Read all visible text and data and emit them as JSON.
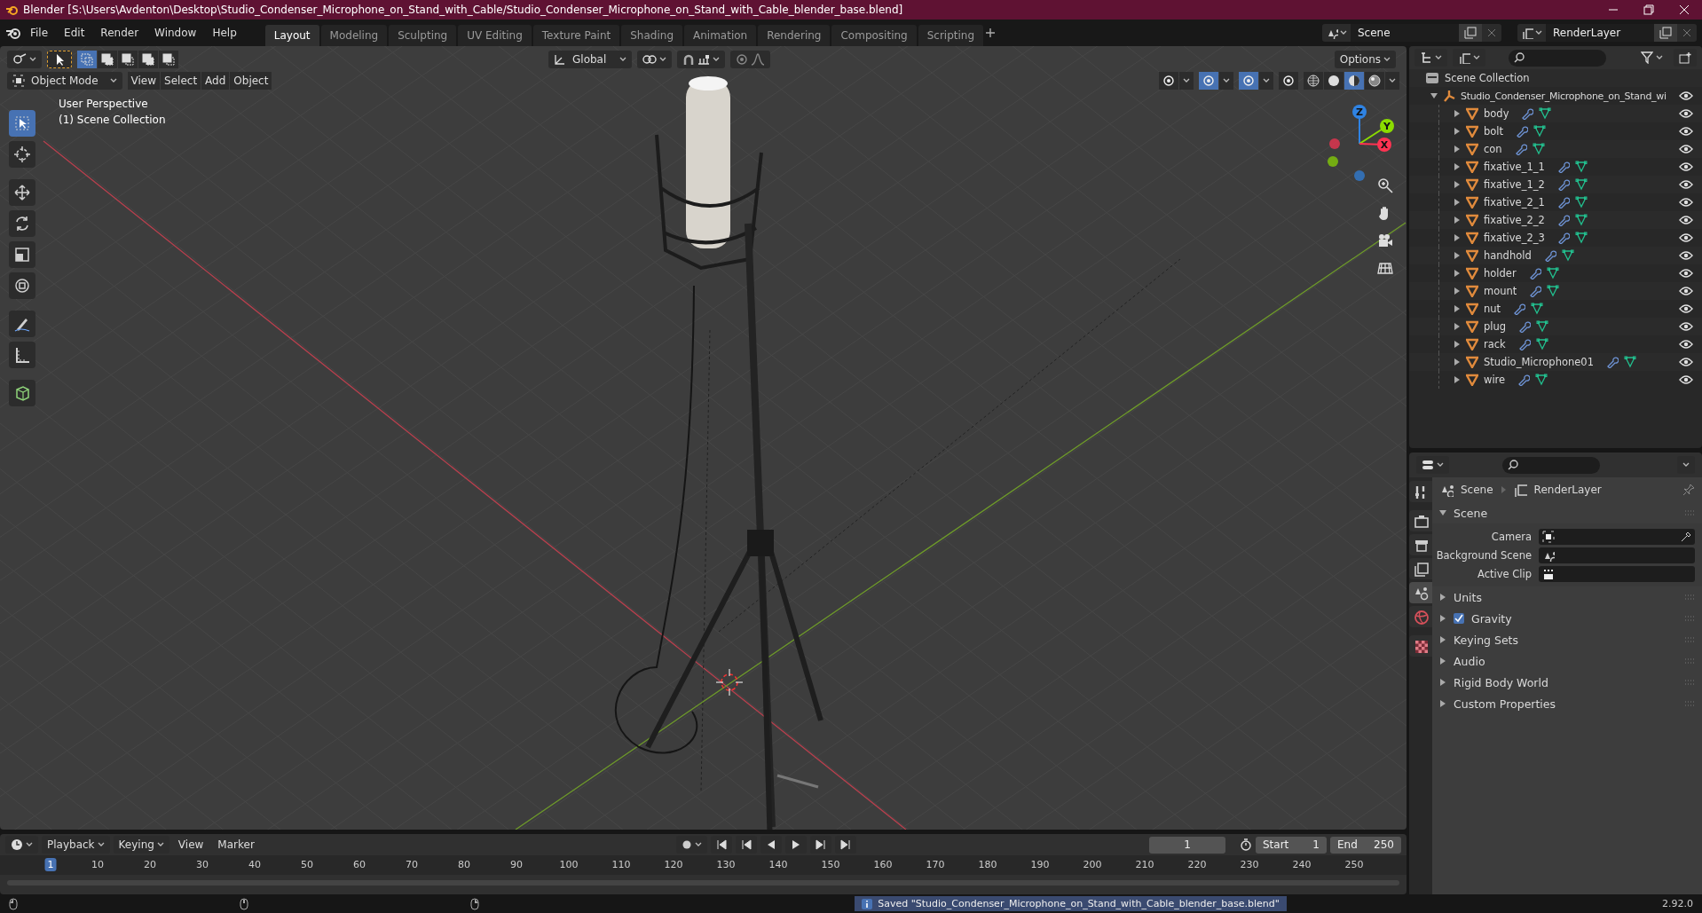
{
  "title_bar": {
    "title": "Blender [S:\\Users\\Avdenton\\Desktop\\Studio_Condenser_Microphone_on_Stand_with_Cable/Studio_Condenser_Microphone_on_Stand_with_Cable_blender_base.blend]"
  },
  "menu": [
    "File",
    "Edit",
    "Render",
    "Window",
    "Help"
  ],
  "workspaces": [
    {
      "label": "Layout",
      "selected": true
    },
    {
      "label": "Modeling",
      "selected": false
    },
    {
      "label": "Sculpting",
      "selected": false
    },
    {
      "label": "UV Editing",
      "selected": false
    },
    {
      "label": "Texture Paint",
      "selected": false
    },
    {
      "label": "Shading",
      "selected": false
    },
    {
      "label": "Animation",
      "selected": false
    },
    {
      "label": "Rendering",
      "selected": false
    },
    {
      "label": "Compositing",
      "selected": false
    },
    {
      "label": "Scripting",
      "selected": false
    }
  ],
  "scene": {
    "value": "Scene"
  },
  "view_layer": {
    "value": "RenderLayer"
  },
  "viewport": {
    "select_modes": [
      {
        "selected": true
      },
      {
        "selected": false
      },
      {
        "selected": false
      },
      {
        "selected": false
      },
      {
        "selected": false
      }
    ],
    "orientation": "Global",
    "snap": {
      "on": false
    },
    "proportional": {
      "on": false
    },
    "options": "Options",
    "mode": "Object Mode",
    "menus": [
      "View",
      "Select",
      "Add",
      "Object"
    ],
    "toggles": [
      {
        "kind": "visibility",
        "on": false
      },
      {
        "kind": "gizmo",
        "on": true
      },
      {
        "kind": "overlay",
        "on": true
      },
      {
        "kind": "xray",
        "on": false
      }
    ],
    "shading_modes": [
      {
        "kind": "wireframe",
        "selected": false
      },
      {
        "kind": "solid",
        "selected": false
      },
      {
        "kind": "material",
        "selected": true
      },
      {
        "kind": "rendered",
        "selected": false
      }
    ],
    "overlay_text": [
      "User Perspective",
      "(1) Scene Collection"
    ],
    "tools": [
      {
        "kind": "select",
        "selected": true
      },
      {
        "kind": "cursor",
        "selected": false
      },
      {
        "kind": "move",
        "selected": false
      },
      {
        "kind": "rotate",
        "selected": false
      },
      {
        "kind": "scale",
        "selected": false
      },
      {
        "kind": "transform",
        "selected": false
      },
      {
        "kind": "annotate",
        "selected": false
      },
      {
        "kind": "measure",
        "selected": false
      },
      {
        "kind": "addcube",
        "selected": false
      }
    ],
    "gizmo": [
      {
        "label": "Z",
        "color": "#2f83e3"
      },
      {
        "label": "Y",
        "color": "#8bdc00"
      },
      {
        "label": "X",
        "color": "#ff3352"
      }
    ]
  },
  "outliner": {
    "root": "Scene Collection",
    "collections": [
      {
        "name": "Studio_Condenser_Microphone_on_Stand_wi",
        "expanded": true,
        "children": [
          {
            "name": "body",
            "expanded": false
          },
          {
            "name": "bolt",
            "expanded": false
          },
          {
            "name": "con",
            "expanded": false
          },
          {
            "name": "fixative_1_1",
            "expanded": false
          },
          {
            "name": "fixative_1_2",
            "expanded": false
          },
          {
            "name": "fixative_2_1",
            "expanded": false
          },
          {
            "name": "fixative_2_2",
            "expanded": false
          },
          {
            "name": "fixative_2_3",
            "expanded": false
          },
          {
            "name": "handhold",
            "expanded": false
          },
          {
            "name": "holder",
            "expanded": false
          },
          {
            "name": "mount",
            "expanded": false
          },
          {
            "name": "nut",
            "expanded": false
          },
          {
            "name": "plug",
            "expanded": false
          },
          {
            "name": "rack",
            "expanded": false
          },
          {
            "name": "Studio_Microphone01",
            "expanded": false
          },
          {
            "name": "wire",
            "expanded": false
          }
        ]
      }
    ]
  },
  "properties": {
    "tabs": [
      {
        "kind": "tool",
        "selected": false
      },
      {
        "kind": "render",
        "selected": false
      },
      {
        "kind": "output",
        "selected": false
      },
      {
        "kind": "viewlayer",
        "selected": false
      },
      {
        "kind": "scene",
        "selected": true
      },
      {
        "kind": "world",
        "selected": false
      },
      {
        "kind": "texture",
        "selected": false
      }
    ],
    "breadcrumb": [
      "Scene",
      "RenderLayer"
    ],
    "panels": [
      {
        "title": "Scene",
        "expanded": true,
        "fields": [
          {
            "label": "Camera",
            "kind": "camera"
          },
          {
            "label": "Background Scene",
            "kind": "scene"
          },
          {
            "label": "Active Clip",
            "kind": "clip"
          }
        ]
      },
      {
        "title": "Units",
        "expanded": false
      },
      {
        "title": "Gravity",
        "expanded": false,
        "checked": true
      },
      {
        "title": "Keying Sets",
        "expanded": false
      },
      {
        "title": "Audio",
        "expanded": false
      },
      {
        "title": "Rigid Body World",
        "expanded": false
      },
      {
        "title": "Custom Properties",
        "expanded": false
      }
    ]
  },
  "timeline": {
    "menus": [
      "Playback",
      "Keying",
      "View",
      "Marker"
    ],
    "auto_keying": {
      "on": false
    },
    "current_frame": "1",
    "start_label": "Start",
    "start": "1",
    "end_label": "End",
    "end": "250",
    "ruler": [
      {
        "label": "1",
        "selected": true
      },
      {
        "label": "10",
        "selected": false
      },
      {
        "label": "20",
        "selected": false
      },
      {
        "label": "30",
        "selected": false
      },
      {
        "label": "40",
        "selected": false
      },
      {
        "label": "50",
        "selected": false
      },
      {
        "label": "60",
        "selected": false
      },
      {
        "label": "70",
        "selected": false
      },
      {
        "label": "80",
        "selected": false
      },
      {
        "label": "90",
        "selected": false
      },
      {
        "label": "100",
        "selected": false
      },
      {
        "label": "110",
        "selected": false
      },
      {
        "label": "120",
        "selected": false
      },
      {
        "label": "130",
        "selected": false
      },
      {
        "label": "140",
        "selected": false
      },
      {
        "label": "150",
        "selected": false
      },
      {
        "label": "160",
        "selected": false
      },
      {
        "label": "170",
        "selected": false
      },
      {
        "label": "180",
        "selected": false
      },
      {
        "label": "190",
        "selected": false
      },
      {
        "label": "200",
        "selected": false
      },
      {
        "label": "210",
        "selected": false
      },
      {
        "label": "220",
        "selected": false
      },
      {
        "label": "230",
        "selected": false
      },
      {
        "label": "240",
        "selected": false
      },
      {
        "label": "250",
        "selected": false
      }
    ]
  },
  "status_bar": {
    "message": "Saved \"Studio_Condenser_Microphone_on_Stand_with_Cable_blender_base.blend\"",
    "version": "2.92.0"
  }
}
